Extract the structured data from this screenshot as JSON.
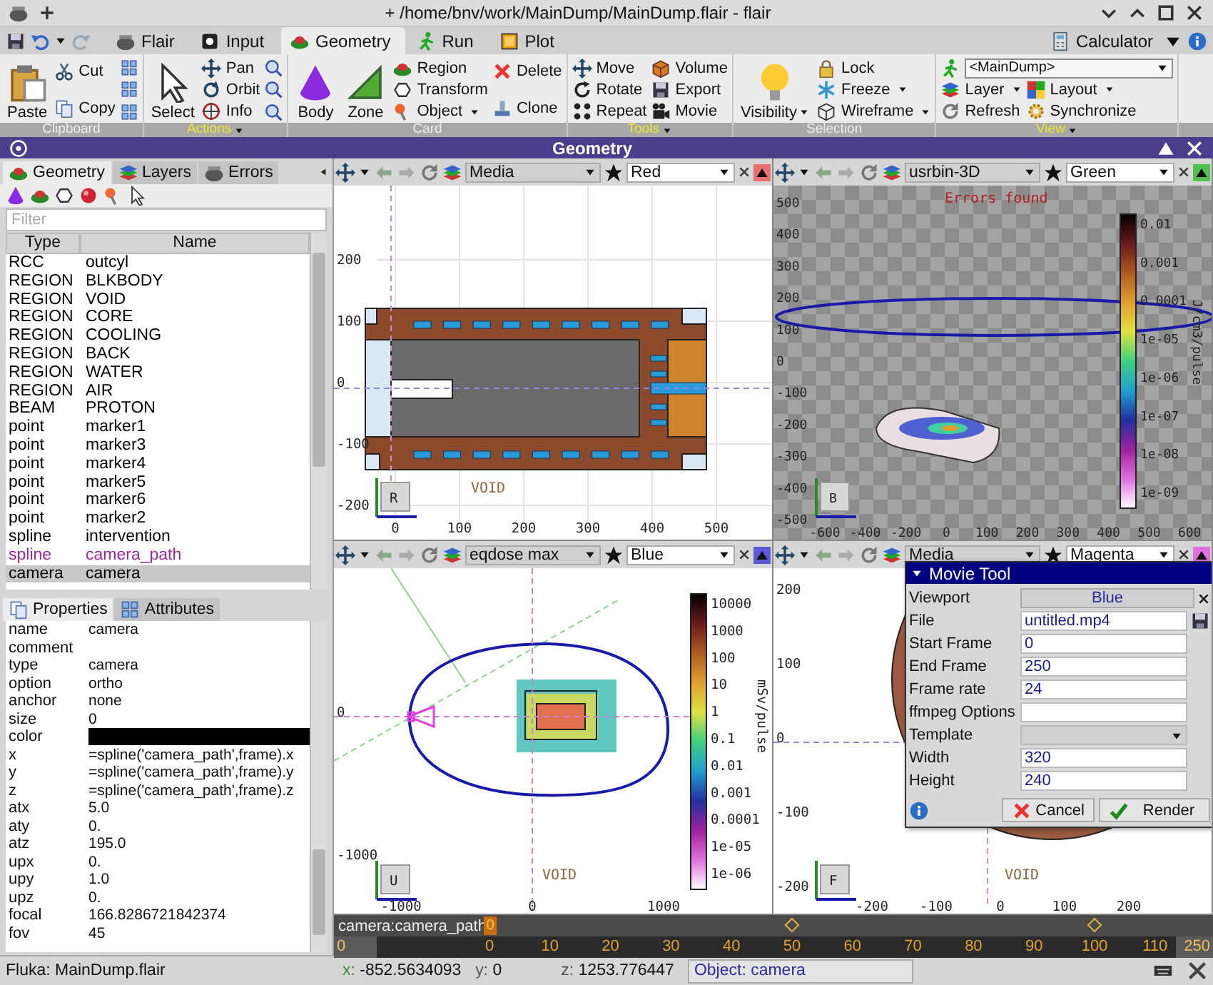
{
  "window": {
    "title": "+ /home/bnv/work/MainDump/MainDump.flair - flair"
  },
  "tabs": [
    {
      "label": "Flair",
      "selected": false
    },
    {
      "label": "Input",
      "selected": false
    },
    {
      "label": "Geometry",
      "selected": true
    },
    {
      "label": "Run",
      "selected": false
    },
    {
      "label": "Plot",
      "selected": false
    }
  ],
  "calculator": "Calculator",
  "ribbon": [
    {
      "title": "Clipboard",
      "menu": false,
      "columns": [
        [
          {
            "kind": "large",
            "label": "Paste"
          }
        ],
        [
          {
            "kind": "small",
            "label": "Cut"
          },
          {
            "kind": "small",
            "label": "Copy"
          }
        ],
        [
          {
            "kind": "icon"
          },
          {
            "kind": "icon"
          },
          {
            "kind": "icon"
          }
        ]
      ]
    },
    {
      "title": "Actions",
      "menu": true,
      "columns": [
        [
          {
            "kind": "large",
            "label": "Select"
          }
        ],
        [
          {
            "kind": "small",
            "label": "Pan"
          },
          {
            "kind": "small",
            "label": "Orbit"
          },
          {
            "kind": "small",
            "label": "Info"
          }
        ],
        [
          {
            "kind": "icon"
          },
          {
            "kind": "icon"
          },
          {
            "kind": "icon"
          }
        ]
      ]
    },
    {
      "title": "Card",
      "menu": false,
      "columns": [
        [
          {
            "kind": "large",
            "label": "Body"
          }
        ],
        [
          {
            "kind": "large",
            "label": "Zone"
          }
        ],
        [
          {
            "kind": "small",
            "label": "Region"
          },
          {
            "kind": "small",
            "label": "Transform"
          },
          {
            "kind": "small",
            "label": "Object",
            "dropdown": true
          }
        ],
        [
          {
            "kind": "small",
            "label": "Delete"
          },
          {
            "kind": "small",
            "label": "Clone"
          }
        ]
      ]
    },
    {
      "title": "Tools",
      "menu": true,
      "columns": [
        [
          {
            "kind": "small",
            "label": "Move"
          },
          {
            "kind": "small",
            "label": "Rotate"
          },
          {
            "kind": "small",
            "label": "Repeat"
          }
        ],
        [
          {
            "kind": "small",
            "label": "Volume"
          },
          {
            "kind": "small",
            "label": "Export"
          },
          {
            "kind": "small",
            "label": "Movie"
          }
        ]
      ]
    },
    {
      "title": "Selection",
      "menu": false,
      "columns": [
        [
          {
            "kind": "large",
            "label": "Visibility",
            "dropdown": true
          }
        ],
        [
          {
            "kind": "small",
            "label": "Lock"
          },
          {
            "kind": "small",
            "label": "Freeze",
            "dropdown": true
          },
          {
            "kind": "small",
            "label": "Wireframe",
            "dropdown": true
          }
        ]
      ]
    },
    {
      "title": "View",
      "menu": true,
      "combo": "<MainDump>",
      "columns": [
        [
          {
            "kind": "small",
            "label": "Layer",
            "dropdown": true
          },
          {
            "kind": "small",
            "label": "Refresh"
          }
        ],
        [
          {
            "kind": "small",
            "label": "Layout",
            "dropdown": true
          },
          {
            "kind": "small",
            "label": "Synchronize"
          }
        ]
      ]
    }
  ],
  "panel_title": "Geometry",
  "objects": {
    "tabs": [
      {
        "label": "Geometry",
        "selected": true
      },
      {
        "label": "Layers",
        "selected": false
      },
      {
        "label": "Errors",
        "selected": false
      }
    ],
    "filter": {
      "placeholder": "Filter"
    },
    "columns": [
      "Type",
      "Name"
    ],
    "rows": [
      {
        "type": "RCC",
        "name": "outcyl",
        "color": "#000000",
        "selected": false
      },
      {
        "type": "REGION",
        "name": "BLKBODY",
        "color": "#000000",
        "selected": false
      },
      {
        "type": "REGION",
        "name": "VOID",
        "color": "#000000",
        "selected": false
      },
      {
        "type": "REGION",
        "name": "CORE",
        "color": "#000000",
        "selected": false
      },
      {
        "type": "REGION",
        "name": "COOLING",
        "color": "#000000",
        "selected": false
      },
      {
        "type": "REGION",
        "name": "BACK",
        "color": "#000000",
        "selected": false
      },
      {
        "type": "REGION",
        "name": "WATER",
        "color": "#000000",
        "selected": false
      },
      {
        "type": "REGION",
        "name": "AIR",
        "color": "#000000",
        "selected": false
      },
      {
        "type": "BEAM",
        "name": "PROTON",
        "color": "#000000",
        "selected": false
      },
      {
        "type": "point",
        "name": "marker1",
        "color": "#000000",
        "selected": false
      },
      {
        "type": "point",
        "name": "marker3",
        "color": "#000000",
        "selected": false
      },
      {
        "type": "point",
        "name": "marker4",
        "color": "#000000",
        "selected": false
      },
      {
        "type": "point",
        "name": "marker5",
        "color": "#000000",
        "selected": false
      },
      {
        "type": "point",
        "name": "marker6",
        "color": "#000000",
        "selected": false
      },
      {
        "type": "point",
        "name": "marker2",
        "color": "#000000",
        "selected": false
      },
      {
        "type": "spline",
        "name": "intervention",
        "color": "#000000",
        "selected": false
      },
      {
        "type": "spline",
        "name": "camera_path",
        "color": "#9a2a9a",
        "selected": false
      },
      {
        "type": "camera",
        "name": "camera",
        "color": "#000000",
        "selected": true
      }
    ]
  },
  "properties": {
    "tabs": [
      {
        "label": "Properties",
        "selected": true
      },
      {
        "label": "Attributes",
        "selected": false
      }
    ],
    "rows": [
      {
        "name": "name",
        "kind": "text",
        "value": "camera"
      },
      {
        "name": "comment",
        "kind": "text"
      },
      {
        "name": "type",
        "kind": "text",
        "value": "camera"
      },
      {
        "name": "option",
        "kind": "text",
        "value": "ortho"
      },
      {
        "name": "anchor",
        "kind": "text",
        "value": "none"
      },
      {
        "name": "size",
        "kind": "text",
        "value": "0"
      },
      {
        "name": "color",
        "kind": "swatch",
        "color": "#000000"
      },
      {
        "name": "x",
        "kind": "text",
        "value": "=spline('camera_path',frame).x"
      },
      {
        "name": "y",
        "kind": "text",
        "value": "=spline('camera_path',frame).y"
      },
      {
        "name": "z",
        "kind": "text",
        "value": "=spline('camera_path',frame).z"
      },
      {
        "name": "atx",
        "kind": "text",
        "value": "5.0"
      },
      {
        "name": "aty",
        "kind": "text",
        "value": "0."
      },
      {
        "name": "atz",
        "kind": "text",
        "value": "195.0"
      },
      {
        "name": "upx",
        "kind": "text",
        "value": "0."
      },
      {
        "name": "upy",
        "kind": "text",
        "value": "1.0"
      },
      {
        "name": "upz",
        "kind": "text",
        "value": "0."
      },
      {
        "name": "focal",
        "kind": "text",
        "value": "166.8286721842374"
      },
      {
        "name": "fov",
        "kind": "text",
        "value": "45"
      }
    ]
  },
  "viewports": [
    {
      "kind": "media",
      "layer": "Media",
      "color_name": "Red",
      "color": "#e87070",
      "x_ticks": [
        "0",
        "100",
        "200",
        "300",
        "400",
        "500"
      ],
      "y_ticks": [
        "200",
        "100",
        "0",
        "-100",
        "-200"
      ],
      "region_label": "VOID",
      "cube_label": "R"
    },
    {
      "kind": "usrbin",
      "layer": "usrbin-3D",
      "color_name": "Green",
      "color": "#50c050",
      "message": "Errors found",
      "x_ticks": [
        "-600",
        "-400",
        "-200",
        "0",
        "100",
        "200",
        "300",
        "400",
        "500",
        "600"
      ],
      "y_ticks": [
        "500",
        "400",
        "300",
        "200",
        "100",
        "0",
        "-100",
        "-200",
        "-300",
        "-400",
        "-500"
      ],
      "cube_label": "B",
      "colorbar": {
        "unit": "J/cm3/pulse",
        "labels": [
          "0.01",
          "0.001",
          "0.0001",
          "1e-05",
          "1e-06",
          "1e-07",
          "1e-08",
          "1e-09"
        ]
      }
    },
    {
      "kind": "eqdose",
      "layer": "eqdose max",
      "color_name": "Blue",
      "color": "#5a5ad8",
      "x_ticks": [
        "-1000",
        "0",
        "1000"
      ],
      "y_ticks": [
        "0",
        "-1000"
      ],
      "region_label": "VOID",
      "cube_label": "U",
      "colorbar": {
        "unit": "mSv/pulse",
        "labels": [
          "10000",
          "1000",
          "100",
          "10",
          "1",
          "0.1",
          "0.01",
          "0.001",
          "0.0001",
          "1e-05",
          "1e-06"
        ]
      }
    },
    {
      "kind": "media_front",
      "layer": "Media",
      "color_name": "Magenta",
      "color": "#e070e0",
      "x_ticks": [
        "-200",
        "-100",
        "0",
        "100",
        "200"
      ],
      "y_ticks": [
        "200",
        "100",
        "0",
        "-100",
        "-200"
      ],
      "region_label": "VOID",
      "cube_label": "F"
    }
  ],
  "movie_tool": {
    "title": "Movie Tool",
    "fields": [
      {
        "label": "Viewport",
        "kind": "button",
        "value": "Blue"
      },
      {
        "label": "File",
        "kind": "file",
        "value": "untitled.mp4"
      },
      {
        "label": "Start Frame",
        "kind": "text",
        "value": "0"
      },
      {
        "label": "End Frame",
        "kind": "text",
        "value": "250"
      },
      {
        "label": "Frame rate",
        "kind": "text",
        "value": "24"
      },
      {
        "label": "ffmpeg Options",
        "kind": "text"
      },
      {
        "label": "Template",
        "kind": "select"
      },
      {
        "label": "Width",
        "kind": "text",
        "value": "320"
      },
      {
        "label": "Height",
        "kind": "text",
        "value": "240"
      }
    ],
    "buttons": [
      {
        "label": "Cancel",
        "kind": "cancel"
      },
      {
        "label": "Render",
        "kind": "confirm"
      }
    ]
  },
  "timeline": {
    "label": "camera:camera_path",
    "current": "0",
    "start": "0",
    "end": "250",
    "ticks": [
      "0",
      "10",
      "20",
      "30",
      "40",
      "50",
      "60",
      "70",
      "80",
      "90",
      "100",
      "110"
    ]
  },
  "status_bar": {
    "file": "Fluka: MainDump.flair",
    "coords": [
      {
        "label": "x:",
        "value": "-852.5634093"
      },
      {
        "label": "y:",
        "value": "0"
      },
      {
        "label": "z:",
        "value": "1253.776447"
      }
    ],
    "object": "Object: camera"
  }
}
